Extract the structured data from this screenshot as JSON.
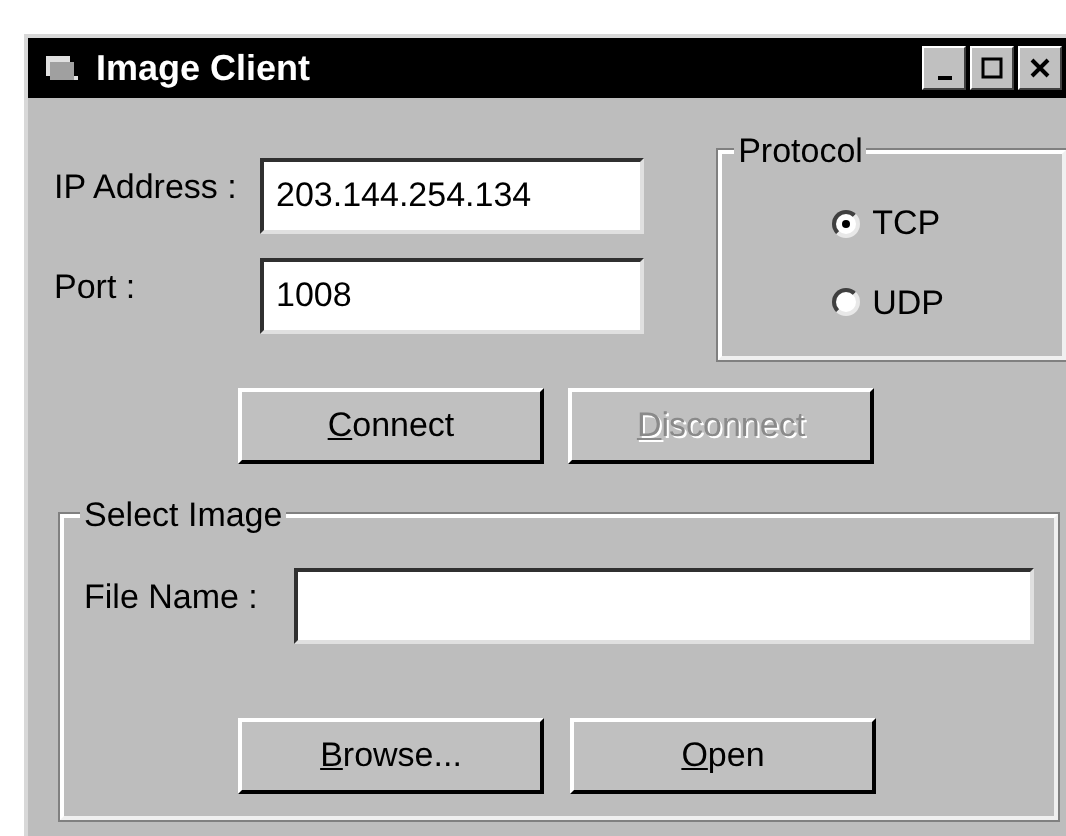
{
  "window": {
    "title": "Image Client"
  },
  "connection": {
    "ip_label": "IP Address :",
    "ip_value": "203.144.254.134",
    "port_label": "Port :",
    "port_value": "1008"
  },
  "protocol": {
    "title": "Protocol",
    "options": [
      {
        "label": "TCP",
        "selected": true
      },
      {
        "label": "UDP",
        "selected": false
      }
    ]
  },
  "connection_buttons": [
    {
      "label": "Connect",
      "mnemonic": true,
      "disabled": false
    },
    {
      "label": "Disconnect",
      "mnemonic": true,
      "disabled": true
    }
  ],
  "select_image": {
    "title": "Select Image",
    "file_label": "File Name :",
    "buttons": [
      {
        "label": "Browse...",
        "mnemonic": true,
        "disabled": false
      },
      {
        "label": "Open",
        "mnemonic": true,
        "disabled": false
      }
    ]
  }
}
